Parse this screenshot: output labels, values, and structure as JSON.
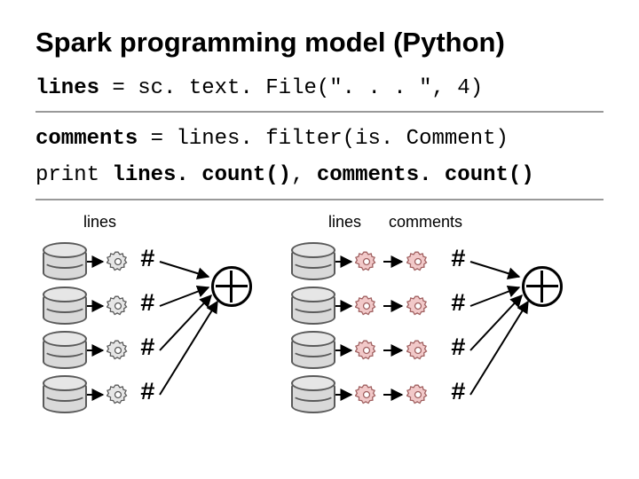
{
  "title": "Spark programming model (Python)",
  "code": {
    "line1_lhs": "lines",
    "line1_eq": " = ",
    "line1_rhs": "sc. text. File(\". . . \", 4)",
    "line2_lhs": "comments",
    "line2_eq": " = ",
    "line2_rhs": "lines. filter(is. Comment)",
    "line3_a": "print ",
    "line3_b": "lines. count()",
    "line3_c": ", ",
    "line3_d": "comments. count()"
  },
  "labels": {
    "left_lines": "lines",
    "right_lines": "lines",
    "right_comments": "comments"
  },
  "hash": "#",
  "rows": 4,
  "colors": {
    "gear_fill": "#e6e6e6",
    "gear_stroke": "#5a5a5a",
    "gear_fill_red": "#f2c9c9",
    "gear_stroke_red": "#a06060",
    "cyl_fill": "#d9d9d9",
    "cyl_stroke": "#5a5a5a",
    "arrow": "#000000"
  }
}
